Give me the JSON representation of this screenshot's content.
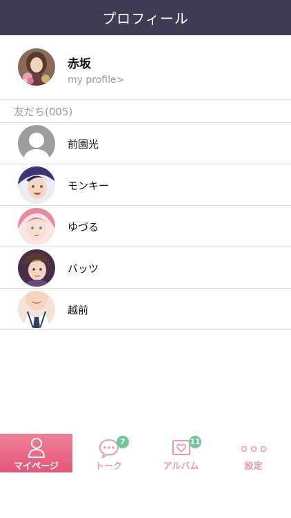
{
  "header": {
    "title": "プロフィール"
  },
  "my_profile": {
    "name": "赤坂",
    "link": "my profile>"
  },
  "friends_section": {
    "title": "友だち(005)"
  },
  "friends": [
    {
      "name": "前園光"
    },
    {
      "name": "モンキー"
    },
    {
      "name": "ゆづる"
    },
    {
      "name": "バッツ"
    },
    {
      "name": "越前"
    }
  ],
  "tabs": [
    {
      "label": "マイページ",
      "active": true,
      "icon": "person-icon"
    },
    {
      "label": "トーク",
      "badge": "7",
      "icon": "chat-bubble-icon"
    },
    {
      "label": "アルバム",
      "badge": "11",
      "icon": "heart-album-icon"
    },
    {
      "label": "設定",
      "icon": "dots-icon"
    }
  ],
  "colors": {
    "header_bg": "#3f3d54",
    "accent": "#e4577a",
    "accent_light": "#f09aa9",
    "badge": "#6cc79a"
  }
}
